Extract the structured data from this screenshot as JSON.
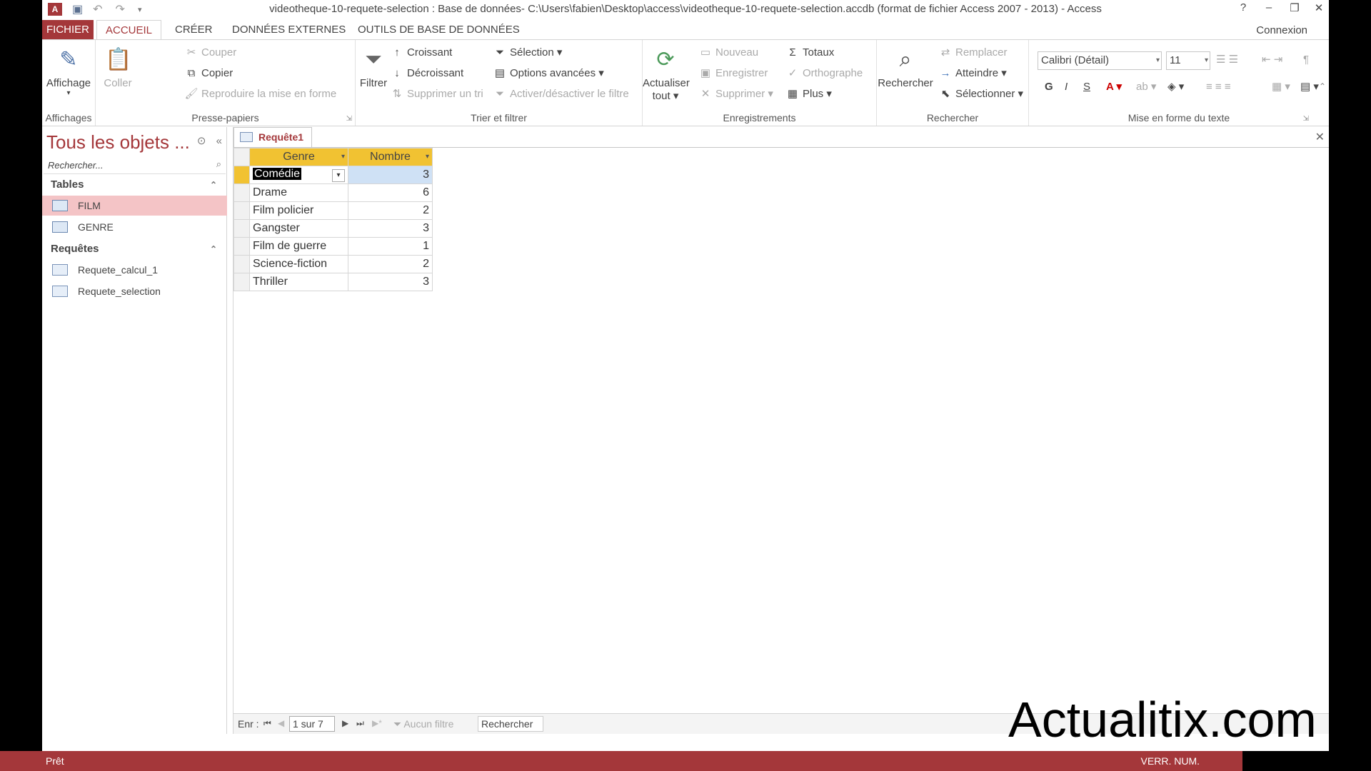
{
  "title": "videotheque-10-requete-selection : Base de données- C:\\Users\\fabien\\Desktop\\access\\videotheque-10-requete-selection.accdb (format de fichier Access 2007 - 2013) - Access",
  "window_controls": {
    "help": "?",
    "minimize": "–",
    "restore": "❐",
    "close": "✕"
  },
  "tabs": [
    "FICHIER",
    "ACCUEIL",
    "CRÉER",
    "DONNÉES EXTERNES",
    "OUTILS DE BASE DE DONNÉES"
  ],
  "connexion": "Connexion",
  "ribbon": {
    "affichages": {
      "label": "Affichages",
      "affichage": "Affichage"
    },
    "presse": {
      "label": "Presse-papiers",
      "coller": "Coller",
      "couper": "Couper",
      "copier": "Copier",
      "reproduire": "Reproduire la mise en forme"
    },
    "trier": {
      "label": "Trier et filtrer",
      "filtrer": "Filtrer",
      "croissant": "Croissant",
      "decroissant": "Décroissant",
      "supprimer_tri": "Supprimer un tri",
      "selection": "Sélection",
      "options": "Options avancées",
      "activer": "Activer/désactiver le filtre"
    },
    "enreg": {
      "label": "Enregistrements",
      "actualiser": "Actualiser",
      "tout": "tout",
      "nouveau": "Nouveau",
      "enregistrer": "Enregistrer",
      "supprimer": "Supprimer",
      "totaux": "Totaux",
      "orthographe": "Orthographe",
      "plus": "Plus"
    },
    "rechercher": {
      "label": "Rechercher",
      "rechercher": "Rechercher",
      "remplacer": "Remplacer",
      "atteindre": "Atteindre",
      "selectionner": "Sélectionner"
    },
    "format": {
      "label": "Mise en forme du texte",
      "font": "Calibri (Détail)",
      "size": "11",
      "bold": "G",
      "italic": "I",
      "underline": "S"
    }
  },
  "nav": {
    "title": "Tous les objets ...",
    "search_placeholder": "Rechercher...",
    "tables_label": "Tables",
    "tables": [
      "FILM",
      "GENRE"
    ],
    "queries_label": "Requêtes",
    "queries": [
      "Requete_calcul_1",
      "Requete_selection"
    ]
  },
  "document": {
    "tab": "Requête1",
    "columns": [
      "Genre",
      "Nombre"
    ],
    "rows": [
      {
        "genre": "Comédie",
        "nombre": "3"
      },
      {
        "genre": "Drame",
        "nombre": "6"
      },
      {
        "genre": "Film policier",
        "nombre": "2"
      },
      {
        "genre": "Gangster",
        "nombre": "3"
      },
      {
        "genre": "Film de guerre",
        "nombre": "1"
      },
      {
        "genre": "Science-fiction",
        "nombre": "2"
      },
      {
        "genre": "Thriller",
        "nombre": "3"
      }
    ]
  },
  "recnav": {
    "label": "Enr :",
    "counter": "1 sur 7",
    "filter": "Aucun filtre",
    "search": "Rechercher"
  },
  "status": {
    "left": "Prêt",
    "right": "VERR. NUM."
  },
  "watermark": "Actualitix.com",
  "colors": {
    "accent": "#a4373a",
    "header_yellow": "#f1c232"
  }
}
